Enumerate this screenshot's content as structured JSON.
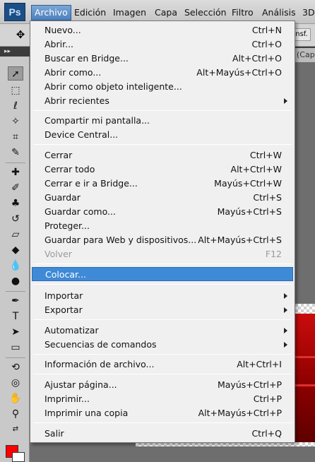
{
  "menubar": {
    "logo": "Ps",
    "items": [
      "Archivo",
      "Edición",
      "Imagen",
      "Capa",
      "Selección",
      "Filtro",
      "Análisis",
      "3D"
    ],
    "active": "Archivo"
  },
  "options_bar": {
    "right_text": "nsf."
  },
  "document": {
    "tab_title": "(Cap"
  },
  "colors": {
    "foreground": "#ff0000",
    "background": "#ffffff",
    "highlight": "#3e8ad7"
  },
  "file_menu": {
    "items": [
      {
        "label": "Nuevo...",
        "shortcut": "Ctrl+N"
      },
      {
        "label": "Abrir...",
        "shortcut": "Ctrl+O"
      },
      {
        "label": "Buscar en Bridge...",
        "shortcut": "Alt+Ctrl+O"
      },
      {
        "label": "Abrir como...",
        "shortcut": "Alt+Mayús+Ctrl+O"
      },
      {
        "label": "Abrir como objeto inteligente...",
        "shortcut": ""
      },
      {
        "label": "Abrir recientes",
        "shortcut": "",
        "submenu": true
      },
      {
        "label": "Compartir mi pantalla...",
        "shortcut": ""
      },
      {
        "label": "Device Central...",
        "shortcut": ""
      },
      {
        "label": "Cerrar",
        "shortcut": "Ctrl+W"
      },
      {
        "label": "Cerrar todo",
        "shortcut": "Alt+Ctrl+W"
      },
      {
        "label": "Cerrar e ir a Bridge...",
        "shortcut": "Mayús+Ctrl+W"
      },
      {
        "label": "Guardar",
        "shortcut": "Ctrl+S"
      },
      {
        "label": "Guardar como...",
        "shortcut": "Mayús+Ctrl+S"
      },
      {
        "label": "Proteger...",
        "shortcut": ""
      },
      {
        "label": "Guardar para Web y dispositivos...",
        "shortcut": "Alt+Mayús+Ctrl+S"
      },
      {
        "label": "Volver",
        "shortcut": "F12",
        "disabled": true
      },
      {
        "label": "Colocar...",
        "shortcut": "",
        "highlighted": true
      },
      {
        "label": "Importar",
        "shortcut": "",
        "submenu": true
      },
      {
        "label": "Exportar",
        "shortcut": "",
        "submenu": true
      },
      {
        "label": "Automatizar",
        "shortcut": "",
        "submenu": true
      },
      {
        "label": "Secuencias de comandos",
        "shortcut": "",
        "submenu": true
      },
      {
        "label": "Información de archivo...",
        "shortcut": "Alt+Ctrl+I"
      },
      {
        "label": "Ajustar página...",
        "shortcut": "Mayús+Ctrl+P"
      },
      {
        "label": "Imprimir...",
        "shortcut": "Ctrl+P"
      },
      {
        "label": "Imprimir una copia",
        "shortcut": "Alt+Mayús+Ctrl+P"
      },
      {
        "label": "Salir",
        "shortcut": "Ctrl+Q"
      }
    ]
  }
}
